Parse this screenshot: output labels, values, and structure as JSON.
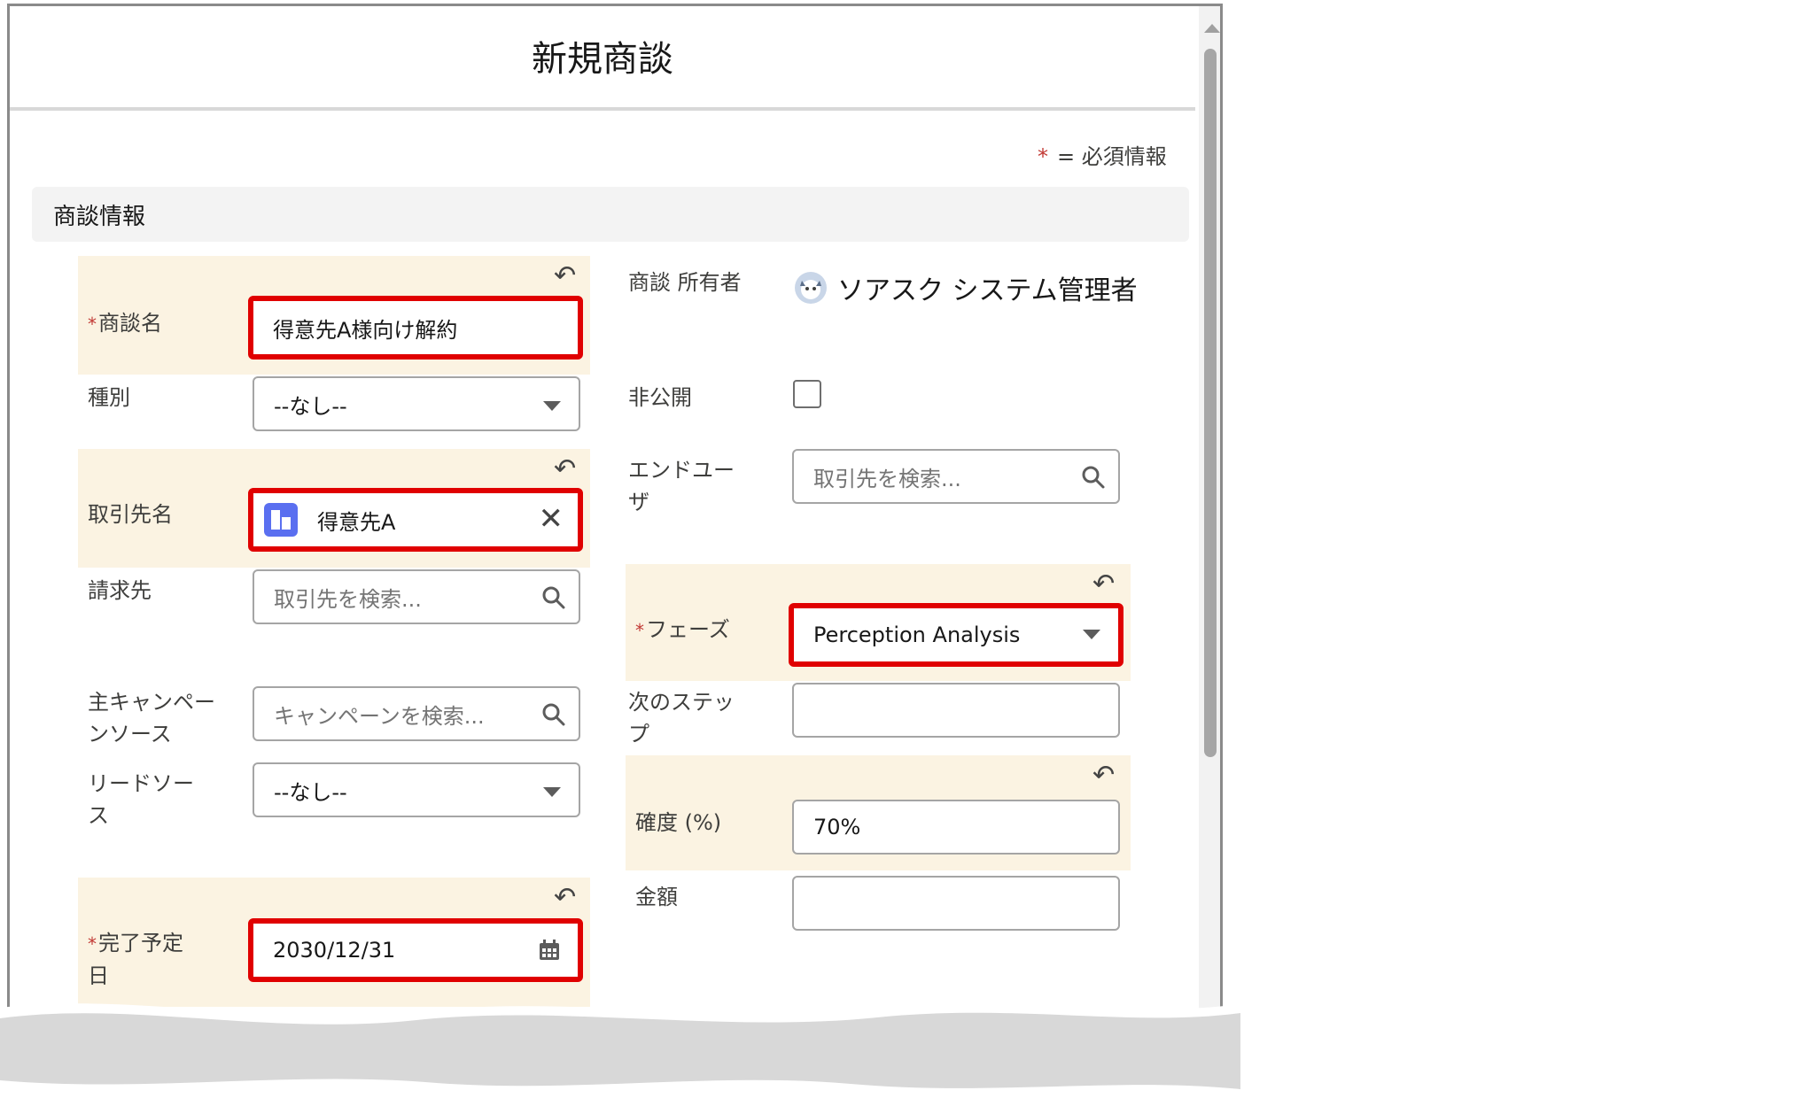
{
  "modal": {
    "title": "新規商談",
    "required_note": "= 必須情報",
    "required_star": "*",
    "section_title": "商談情報"
  },
  "fields": {
    "opportunity_name": {
      "label": "商談名",
      "value": "得意先A様向け解約"
    },
    "type": {
      "label": "種別",
      "value": "--なし--"
    },
    "account_name": {
      "label": "取引先名",
      "value": "得意先A"
    },
    "billing_to": {
      "label": "請求先",
      "placeholder": "取引先を検索..."
    },
    "primary_campaign": {
      "label": "主キャンペーンソース",
      "placeholder": "キャンペーンを検索..."
    },
    "lead_source": {
      "label": "リードソース",
      "value": "--なし--"
    },
    "close_date": {
      "label": "完了予定日",
      "value": "2030/12/31"
    },
    "owner": {
      "label": "商談 所有者",
      "value": "ソアスク システム管理者"
    },
    "private": {
      "label": "非公開",
      "checked": false
    },
    "end_user": {
      "label": "エンドユーザ",
      "placeholder": "取引先を検索..."
    },
    "stage": {
      "label": "フェーズ",
      "value": "Perception Analysis"
    },
    "next_step": {
      "label": "次のステップ",
      "value": ""
    },
    "probability": {
      "label": "確度 (%)",
      "value": "70%"
    },
    "amount": {
      "label": "金額",
      "value": ""
    }
  },
  "colors": {
    "highlight": "#fbf3e2",
    "annotation_red": "#e00000",
    "required_star": "#c23934",
    "section_bg": "#f3f3f3"
  },
  "icons": [
    "undo-icon",
    "caret-down-icon",
    "search-icon",
    "calendar-icon",
    "close-icon",
    "account-icon",
    "user-avatar-icon"
  ]
}
